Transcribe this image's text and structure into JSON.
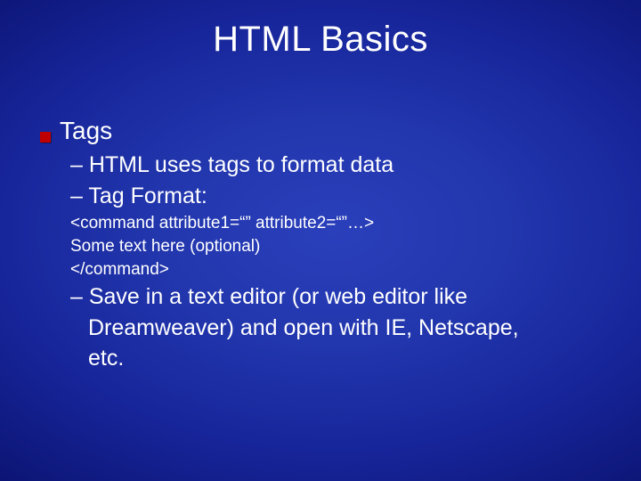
{
  "slide": {
    "title": "HTML Basics",
    "bullet1": "Tags",
    "sub1": "– HTML uses tags to format data",
    "sub2": "– Tag Format:",
    "code1": "<command attribute1=“” attribute2=“”…>",
    "code2": "Some text here (optional)",
    "code3": "</command>",
    "sub3a": "– Save in a text editor (or web editor like",
    "sub3b": "Dreamweaver) and open with IE, Netscape,",
    "sub3c": "etc."
  }
}
